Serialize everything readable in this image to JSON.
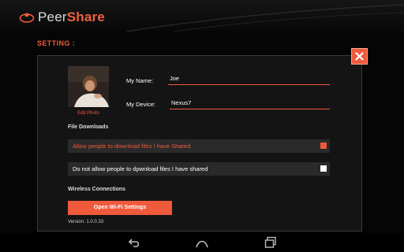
{
  "app": {
    "name_part1": "Peer",
    "name_part2": "Share"
  },
  "page": {
    "title": "SETTING :"
  },
  "profile": {
    "edit_photo_label": "Edit Photo"
  },
  "fields": {
    "name_label": "My Name:",
    "name_value": "Joe",
    "device_label": "My Device:",
    "device_value": "Nexus7"
  },
  "downloads": {
    "title": "File Downloads",
    "options": [
      {
        "label": "Allow people to download files I have Shared",
        "selected": true
      },
      {
        "label": "Do not allow people to dpwnload files I have shared",
        "selected": false
      }
    ]
  },
  "wireless": {
    "title": "Wireless Connections",
    "button_label": "Open Wi-Fi Settings"
  },
  "version": "Version: 1.0.0.33",
  "nav": {
    "icons": [
      "back-icon",
      "home-icon",
      "recents-icon"
    ]
  },
  "colors": {
    "accent": "#ef5a3c",
    "panel": "#141414",
    "option_bg": "#2a2a2a",
    "background": "#050505"
  }
}
